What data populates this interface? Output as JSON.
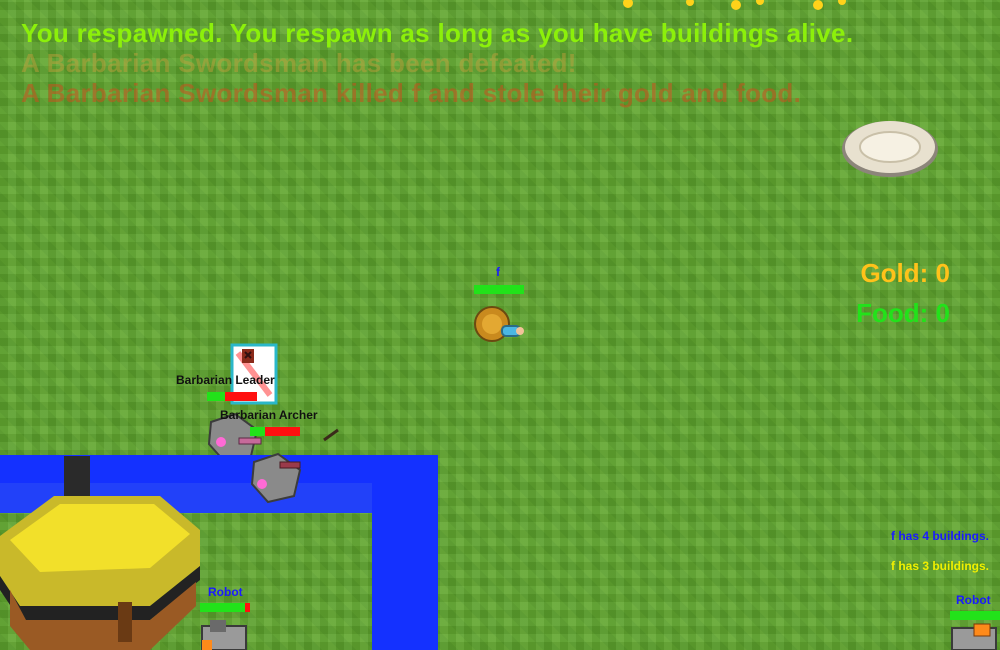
{
  "messages": [
    "You respawned. You respawn as long as you have buildings alive.",
    "A Barbarian Swordsman has been defeated!",
    "A Barbarian Swordsman killed f and stole their gold and food."
  ],
  "resources": {
    "gold_label": "Gold: 0",
    "food_label": "Food: 0"
  },
  "player": {
    "name": "f",
    "health": 1.0
  },
  "enemies": [
    {
      "name": "Barbarian Leader",
      "health": 0.35
    },
    {
      "name": "Barbarian Archer",
      "health": 0.3
    }
  ],
  "robots": [
    {
      "name": "Robot",
      "health": 0.9
    },
    {
      "name": "Robot",
      "health": 1.0
    }
  ],
  "building_counts": [
    {
      "text": "f has 4 buildings.",
      "color": "#1a1aff"
    },
    {
      "text": "f has 3 buildings.",
      "color": "#f0f000"
    }
  ],
  "colors": {
    "grass": "#5fa52e",
    "wall": "#1431ff",
    "gold": "#ffc21a",
    "food": "#22e21a",
    "health": "#22e21a",
    "damage": "#ff1010"
  },
  "icons": [
    "plate-icon",
    "barbarian-banner-icon",
    "house-building-icon",
    "robot-icon"
  ]
}
